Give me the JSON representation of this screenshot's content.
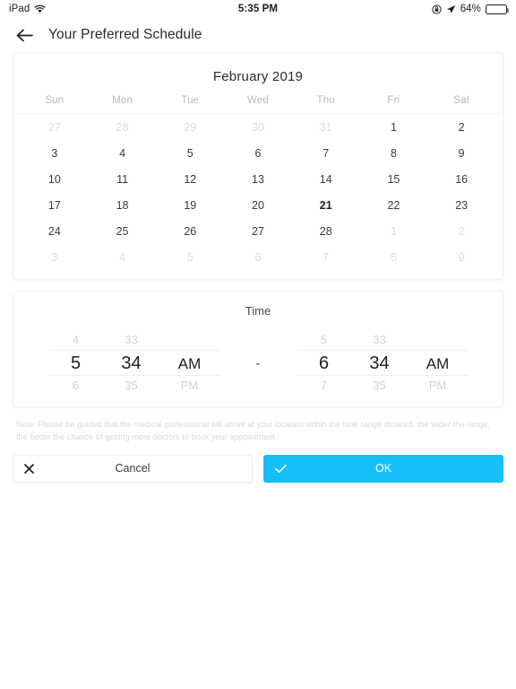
{
  "status_bar": {
    "device": "iPad",
    "wifi_icon": "wifi-icon",
    "time": "5:35 PM",
    "rotation_lock_icon": "rotation-lock-icon",
    "location_icon": "location-arrow-icon",
    "battery_percent": "64%",
    "battery_level": 64,
    "battery_icon": "battery-icon"
  },
  "navbar": {
    "back_icon": "back-arrow-icon",
    "title": "Your Preferred Schedule"
  },
  "calendar": {
    "month_title": "February 2019",
    "weekdays": [
      "Sun",
      "Mon",
      "Tue",
      "Wed",
      "Thu",
      "Fri",
      "Sat"
    ],
    "weeks": [
      [
        {
          "day": "27",
          "muted": true,
          "selected": false
        },
        {
          "day": "28",
          "muted": true,
          "selected": false
        },
        {
          "day": "29",
          "muted": true,
          "selected": false
        },
        {
          "day": "30",
          "muted": true,
          "selected": false
        },
        {
          "day": "31",
          "muted": true,
          "selected": false
        },
        {
          "day": "1",
          "muted": false,
          "selected": false
        },
        {
          "day": "2",
          "muted": false,
          "selected": false
        }
      ],
      [
        {
          "day": "3",
          "muted": false,
          "selected": false
        },
        {
          "day": "4",
          "muted": false,
          "selected": false
        },
        {
          "day": "5",
          "muted": false,
          "selected": false
        },
        {
          "day": "6",
          "muted": false,
          "selected": false
        },
        {
          "day": "7",
          "muted": false,
          "selected": false
        },
        {
          "day": "8",
          "muted": false,
          "selected": false
        },
        {
          "day": "9",
          "muted": false,
          "selected": false
        }
      ],
      [
        {
          "day": "10",
          "muted": false,
          "selected": false
        },
        {
          "day": "11",
          "muted": false,
          "selected": false
        },
        {
          "day": "12",
          "muted": false,
          "selected": false
        },
        {
          "day": "13",
          "muted": false,
          "selected": false
        },
        {
          "day": "14",
          "muted": false,
          "selected": false
        },
        {
          "day": "15",
          "muted": false,
          "selected": false
        },
        {
          "day": "16",
          "muted": false,
          "selected": false
        }
      ],
      [
        {
          "day": "17",
          "muted": false,
          "selected": false
        },
        {
          "day": "18",
          "muted": false,
          "selected": false
        },
        {
          "day": "19",
          "muted": false,
          "selected": false
        },
        {
          "day": "20",
          "muted": false,
          "selected": false
        },
        {
          "day": "21",
          "muted": false,
          "selected": true
        },
        {
          "day": "22",
          "muted": false,
          "selected": false
        },
        {
          "day": "23",
          "muted": false,
          "selected": false
        }
      ],
      [
        {
          "day": "24",
          "muted": false,
          "selected": false
        },
        {
          "day": "25",
          "muted": false,
          "selected": false
        },
        {
          "day": "26",
          "muted": false,
          "selected": false
        },
        {
          "day": "27",
          "muted": false,
          "selected": false
        },
        {
          "day": "28",
          "muted": false,
          "selected": false
        },
        {
          "day": "1",
          "muted": true,
          "selected": false
        },
        {
          "day": "2",
          "muted": true,
          "selected": false
        }
      ],
      [
        {
          "day": "3",
          "muted": true,
          "selected": false
        },
        {
          "day": "4",
          "muted": true,
          "selected": false
        },
        {
          "day": "5",
          "muted": true,
          "selected": false
        },
        {
          "day": "6",
          "muted": true,
          "selected": false
        },
        {
          "day": "7",
          "muted": true,
          "selected": false
        },
        {
          "day": "8",
          "muted": true,
          "selected": false
        },
        {
          "day": "9",
          "muted": true,
          "selected": false
        }
      ]
    ]
  },
  "time_picker": {
    "title": "Time",
    "separator": "-",
    "start": {
      "hour": {
        "prev": "4",
        "selected": "5",
        "next": "6"
      },
      "minute": {
        "prev": "33",
        "selected": "34",
        "next": "35"
      },
      "meridiem": {
        "prev": "",
        "selected": "AM",
        "next": "PM"
      }
    },
    "end": {
      "hour": {
        "prev": "5",
        "selected": "6",
        "next": "7"
      },
      "minute": {
        "prev": "33",
        "selected": "34",
        "next": "35"
      },
      "meridiem": {
        "prev": "",
        "selected": "AM",
        "next": "PM"
      }
    }
  },
  "note": "Note: Please be guided that the medical professional will arrive at your location within the time range dictated. the wider the range, the better the chance of getting more doctors to book your appointment.",
  "actions": {
    "cancel_label": "Cancel",
    "cancel_icon": "close-x-icon",
    "ok_label": "OK",
    "ok_icon": "check-icon",
    "ok_color": "#16bffa"
  }
}
